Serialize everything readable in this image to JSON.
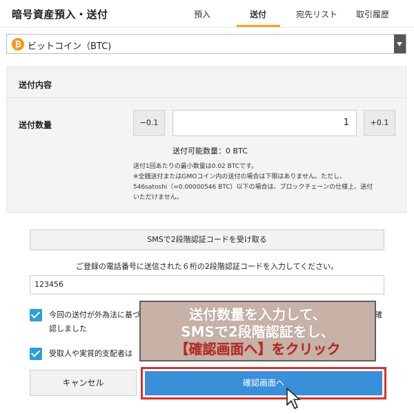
{
  "header": {
    "title": "暗号資産預入・送付",
    "tabs": [
      {
        "label": "預入",
        "active": false
      },
      {
        "label": "送付",
        "active": true
      },
      {
        "label": "宛先リスト",
        "active": false
      },
      {
        "label": "取引履歴",
        "active": false
      }
    ]
  },
  "coin_select": {
    "icon": "bitcoin-icon",
    "icon_glyph": "₿",
    "value": "ビットコイン（BTC)"
  },
  "send_panel": {
    "section_title": "送付内容",
    "quantity_label": "送付数量",
    "decrement_label": "−0.1",
    "increment_label": "+0.1",
    "quantity_value": "1",
    "available_text": "送付可能数量：0 BTC",
    "notes": [
      "送付1回あたりの最小数量は0.02 BTCです。",
      "※全銭送付またはGMOコイン内の送付の場合は下限はありません。ただし、",
      "546satoshi（=0.00000546 BTC）以下の場合は、ブロックチェーンの仕様上、送付",
      "いただけません。"
    ]
  },
  "auth": {
    "sms_button_label": "SMSで2段階認証コードを受け取る",
    "instruction": "ご登録の電話番号に送信された６桁の2段階認証コードを入力してください。",
    "code_value": "123456"
  },
  "checkboxes": [
    {
      "text_line1": "今回の送付が外為法に基づ",
      "text_trail": "確",
      "text_line2": "認しました",
      "checked": true
    },
    {
      "text_line1": "受取人や実質的支配者は",
      "checked": true
    }
  ],
  "buttons": {
    "cancel_label": "キャンセル",
    "confirm_label": "確認画面へ"
  },
  "overlay": {
    "line1": "送付数量を入力して、",
    "line2": "SMSで2段階認証をし、",
    "line3": "【確認画面へ】をクリック"
  },
  "colors": {
    "tab_accent": "#f7a11d",
    "confirm_button": "#3a8fd9",
    "highlight_border": "#d9302a",
    "checkbox": "#2c9fd9",
    "bitcoin": "#f7931a"
  }
}
